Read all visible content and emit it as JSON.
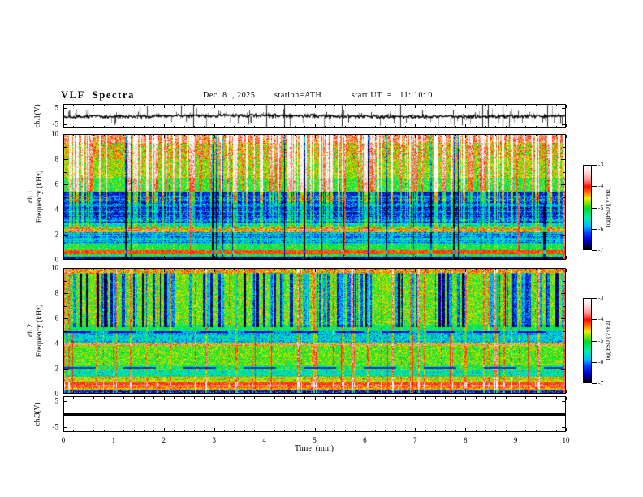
{
  "header": {
    "title": "VLF  Spectra",
    "date": "Dec. 8  , 2025",
    "station": "station=ATH",
    "start_ut": "start UT  =   11: 10: 0"
  },
  "xaxis": {
    "label": "Time  (min)",
    "ticks": [
      0,
      1,
      2,
      3,
      4,
      5,
      6,
      7,
      8,
      9,
      10
    ],
    "range": [
      0,
      10
    ],
    "minor_step_min": 0.2
  },
  "panels": {
    "ch1_wave": {
      "ylabel": "ch.1(V)",
      "yticks": [
        5,
        -5
      ]
    },
    "spec1": {
      "ylabel_channel": "ch.1",
      "ylabel_axis": "Frequency  (kHz)",
      "yticks": [
        0,
        2,
        4,
        6,
        8,
        10
      ],
      "yminor": [
        1,
        3,
        5,
        7,
        9
      ]
    },
    "spec2": {
      "ylabel_channel": "ch.2",
      "ylabel_axis": "Frequency  (kHz)",
      "yticks": [
        0,
        2,
        4,
        6,
        8,
        10
      ],
      "yminor": [
        1,
        3,
        5,
        7,
        9
      ]
    },
    "ch3_wave": {
      "ylabel": "ch.3(V)",
      "yticks": [
        5,
        -5
      ]
    }
  },
  "colorbar": {
    "label": "log(PSD)(V²/Hz)",
    "ticks": [
      -3,
      -4,
      -5,
      -6,
      -7
    ],
    "range": [
      -7,
      -3
    ],
    "stops": [
      [
        -7,
        "#000000"
      ],
      [
        -6.8,
        "#000066"
      ],
      [
        -6.55,
        "#0000cc"
      ],
      [
        -6.2,
        "#0044ff"
      ],
      [
        -5.9,
        "#00bbff"
      ],
      [
        -5.5,
        "#00eeb0"
      ],
      [
        -5.05,
        "#00dd30"
      ],
      [
        -4.8,
        "#7fe400"
      ],
      [
        -4.55,
        "#f2ee00"
      ],
      [
        -4.3,
        "#ff7700"
      ],
      [
        -4.0,
        "#ff0c00"
      ],
      [
        -3.7,
        "#ff8d8d"
      ],
      [
        -3.35,
        "#ffd5d5"
      ],
      [
        -3,
        "#ffffff"
      ]
    ]
  },
  "chart_data": [
    {
      "type": "line",
      "name": "ch1_waveform",
      "title": "ch.1 broadband waveform",
      "x_range_min": [
        0,
        10
      ],
      "ylabel": "ch.1(V)",
      "yticks_v": [
        5,
        -5
      ],
      "baseline_v": 0,
      "noise_amplitude_v": 0.8,
      "spike_probability": 0.3,
      "spike_max_v": 6,
      "seed": 13,
      "description": "Dense black noise trace centred on 0 V with frequent impulsive spikes toward +-5 V across the full 0-10 min record"
    },
    {
      "type": "heatmap",
      "name": "ch1_spectrogram",
      "x_range_min": [
        0,
        10
      ],
      "f_range_khz": [
        0,
        10
      ],
      "f_max": 10,
      "z_label": "log(PSD)(V²/Hz)",
      "z_range": [
        -7,
        -3
      ],
      "seed": 101,
      "bands": [
        [
          9.3,
          10.01,
          -3.9,
          0.8
        ],
        [
          8.0,
          9.3,
          -4.5,
          0.7
        ],
        [
          6.5,
          8.0,
          -4.7,
          0.5
        ],
        [
          5.45,
          6.5,
          -5.0,
          0.45
        ],
        [
          5.15,
          5.45,
          -6.4,
          0.3
        ],
        [
          3.0,
          5.15,
          -6.2,
          0.55
        ],
        [
          2.55,
          3.0,
          -5.5,
          0.4
        ],
        [
          2.2,
          2.55,
          -4.6,
          0.3
        ],
        [
          1.25,
          2.2,
          -5.9,
          0.5
        ],
        [
          0.75,
          1.25,
          -5.2,
          0.4
        ],
        [
          0.45,
          0.75,
          -4.2,
          0.25
        ],
        [
          0.25,
          0.45,
          -5.3,
          0.5
        ],
        [
          0,
          0.25,
          -6.8,
          0.5
        ]
      ],
      "striations": [
        [
          1.2,
          5.15,
          0.35
        ]
      ],
      "streaks": {
        "bright": {
          "prob": 0.25,
          "max_w": 3,
          "delta": 1.4,
          "taper": [
            [
              4.5,
              1
            ],
            [
              2.2,
              0.5
            ],
            [
              0,
              0.15
            ]
          ]
        },
        "dark": {
          "prob": 0.04,
          "max_w": 2,
          "delta": -1.7,
          "f_min": 0,
          "f_max": 10
        },
        "special": {
          "prob": 0.015,
          "max_w": 1,
          "level": -3.9,
          "f_min": 0.3,
          "f_max": 5.3
        }
      },
      "features": [],
      "right_edge_hot": true,
      "description": "Strong red/orange power above 9.3 kHz, yellow-green 6.5-9.3 kHz with bright vertical sferic streaks, deep blue quiet band 3-5.15 kHz with horizontal striations, narrow green line band near 2.2-2.55 kHz, blue 1.25-2.2 kHz, pale green band 0.45-0.75 kHz, near-black below 0.25 kHz"
    },
    {
      "type": "heatmap",
      "name": "ch2_spectrogram",
      "x_range_min": [
        0,
        10
      ],
      "f_range_khz": [
        0,
        10
      ],
      "f_max": 10,
      "z_label": "log(PSD)(V²/Hz)",
      "z_range": [
        -7,
        -3
      ],
      "seed": 202,
      "bands": [
        [
          9.55,
          10.01,
          -4.4,
          0.5
        ],
        [
          5.5,
          9.55,
          -4.85,
          0.45
        ],
        [
          5.05,
          5.5,
          -5.2,
          0.35
        ],
        [
          4.78,
          5.05,
          -5.9,
          0.45
        ],
        [
          4.05,
          4.78,
          -5.6,
          0.5
        ],
        [
          3.8,
          4.05,
          -4.5,
          0.4
        ],
        [
          2.35,
          3.8,
          -4.9,
          0.4
        ],
        [
          1.95,
          2.35,
          -5.15,
          0.45
        ],
        [
          1.35,
          1.95,
          -5.45,
          0.45
        ],
        [
          0.95,
          1.35,
          -4.6,
          0.35
        ],
        [
          0.62,
          0.95,
          -3.95,
          0.3
        ],
        [
          0.3,
          0.62,
          -4.4,
          0.35
        ],
        [
          0.08,
          0.3,
          -6.5,
          0.6
        ],
        [
          0,
          0.08,
          -3.9,
          0.2
        ]
      ],
      "striations": [
        [
          4.05,
          4.78,
          0.3
        ],
        [
          0.3,
          2.4,
          0.25
        ]
      ],
      "streaks": {
        "dark": {
          "prob": 0.18,
          "max_w": 4,
          "delta": -1.5,
          "f_min": 5.3,
          "f_max": 9.6
        },
        "bright": {
          "prob": 0.08,
          "max_w": 2,
          "delta": 0.9,
          "taper": [
            [
              0,
              1
            ]
          ]
        },
        "special": {
          "prob": 0.015,
          "max_w": 1,
          "level": -4.0,
          "f_min": 0,
          "f_max": 4.8
        }
      },
      "features": [
        {
          "f": 3.93,
          "hw": 0.07,
          "level": -3.7,
          "dash": 9,
          "gap": 5
        },
        {
          "f": 4.9,
          "hw": 0.08,
          "level": -6.5,
          "dash": 34,
          "gap": 22
        },
        {
          "f": 2.05,
          "hw": 0.08,
          "level": -6.3,
          "dash": 40,
          "gap": 34
        }
      ],
      "right_edge_hot": true,
      "description": "Mostly green background; dark-blue vertical whistler/quiet streaks 5.3-9.6 kHz; grey broken line near 4.9 kHz; red dashed interference line near 3.9 kHz; orange-brown band 0.62-0.95 kHz; near-black rows below 0.3 kHz with a thin red line at the very bottom"
    },
    {
      "type": "line",
      "name": "ch3_waveform",
      "title": "ch.3 waveform",
      "x_range_min": [
        0,
        10
      ],
      "ylabel": "ch.3(V)",
      "yticks_v": [
        5,
        -5
      ],
      "constant_v": 0,
      "line_thickness_v": 1.2,
      "description": "Flat thick black line at 0 V for the whole record (channel flat)"
    }
  ]
}
